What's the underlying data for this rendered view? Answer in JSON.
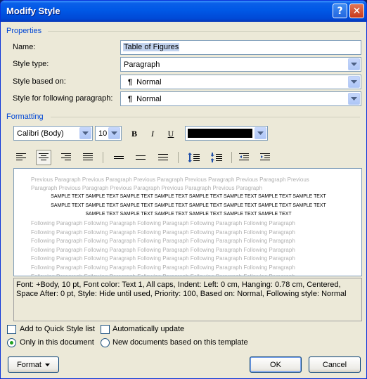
{
  "window": {
    "title": "Modify Style",
    "help_glyph": "?",
    "close_glyph": "✕"
  },
  "properties": {
    "section_label": "Properties",
    "name_label": "Name:",
    "name_value": "Table of Figures",
    "style_type_label": "Style type:",
    "style_type_value": "Paragraph",
    "based_on_label": "Style based on:",
    "based_on_value": "Normal",
    "following_label": "Style for following paragraph:",
    "following_value": "Normal",
    "pilcrow": "¶"
  },
  "formatting": {
    "section_label": "Formatting",
    "font_value": "Calibri (Body)",
    "size_value": "10",
    "bold": "B",
    "italic": "I",
    "underline": "U",
    "font_color": "#000000"
  },
  "preview": {
    "previous_line1": "Previous Paragraph Previous Paragraph Previous Paragraph Previous Paragraph Previous Paragraph Previous",
    "previous_line2": "Paragraph Previous Paragraph Previous Paragraph Previous Paragraph Previous Paragraph",
    "sample_line1": "SAMPLE TEXT SAMPLE TEXT SAMPLE TEXT SAMPLE TEXT SAMPLE TEXT SAMPLE TEXT SAMPLE TEXT SAMPLE TEXT",
    "sample_line2": "SAMPLE TEXT SAMPLE TEXT SAMPLE TEXT SAMPLE TEXT SAMPLE TEXT SAMPLE TEXT SAMPLE TEXT SAMPLE TEXT",
    "sample_line3": "SAMPLE TEXT SAMPLE TEXT SAMPLE TEXT SAMPLE TEXT SAMPLE TEXT SAMPLE TEXT",
    "following_line": "Following Paragraph Following Paragraph Following Paragraph Following Paragraph Following Paragraph"
  },
  "description": "Font: +Body, 10 pt, Font color: Text 1, All caps, Indent: Left:  0 cm, Hanging:  0.78 cm, Centered, Space After:  0 pt, Style: Hide until used, Priority: 100, Based on: Normal, Following style: Normal",
  "options": {
    "add_quick_style": "Add to Quick Style list",
    "auto_update": "Automatically update",
    "only_this_doc": "Only in this document",
    "new_docs": "New documents based on this template"
  },
  "buttons": {
    "format": "Format",
    "ok": "OK",
    "cancel": "Cancel"
  }
}
